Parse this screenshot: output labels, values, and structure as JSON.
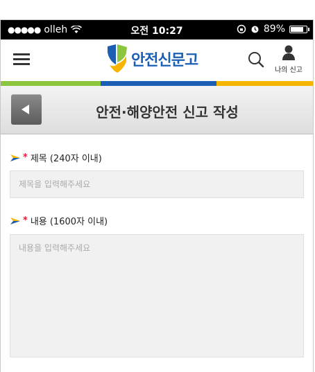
{
  "status_bar": {
    "carrier": "olleh",
    "time": "오전 10:27",
    "battery": "89%",
    "battery_level": 0.89
  },
  "header": {
    "logo_text": "안전신문고",
    "my_report_label": "나의 신고",
    "menu_icon": "hamburger-menu-icon",
    "search_icon": "search-icon",
    "user_icon": "user-icon"
  },
  "stripe_colors": [
    "#8cc63f",
    "#1a5fb4",
    "#f7b500"
  ],
  "page": {
    "title": "안전·해양안전 신고 작성"
  },
  "form": {
    "title_field": {
      "required_mark": "*",
      "label": "제목 (240자 이내)",
      "placeholder": "제목을 입력해주세요",
      "value": ""
    },
    "content_field": {
      "required_mark": "*",
      "label": "내용 (1600자 이내)",
      "placeholder": "내용을 입력해주세요",
      "value": ""
    }
  }
}
